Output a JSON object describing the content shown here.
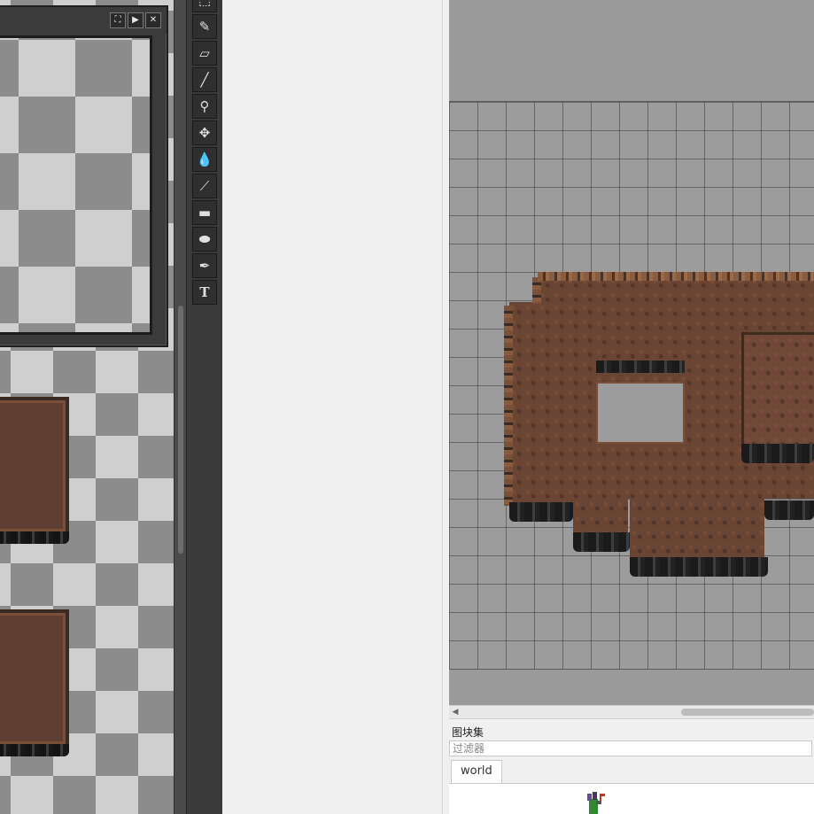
{
  "preview": {
    "buttons": [
      {
        "glyph": "⛶",
        "icon": "fullscreen-icon"
      },
      {
        "glyph": "▶",
        "icon": "play-icon"
      },
      {
        "glyph": "✕",
        "icon": "close-icon"
      }
    ]
  },
  "toolbar": {
    "tools": [
      {
        "glyph": "⬚",
        "icon": "selection-icon"
      },
      {
        "glyph": "✎",
        "icon": "pencil-icon"
      },
      {
        "glyph": "▱",
        "icon": "eraser-icon"
      },
      {
        "glyph": "╱",
        "icon": "brush-icon"
      },
      {
        "glyph": "⚲",
        "icon": "zoom-icon"
      },
      {
        "glyph": "✥",
        "icon": "move-icon"
      },
      {
        "glyph": "💧",
        "icon": "fill-icon"
      },
      {
        "glyph": "⟋",
        "icon": "line-icon"
      },
      {
        "glyph": "▬",
        "icon": "rectangle-icon"
      },
      {
        "glyph": "⬬",
        "icon": "ellipse-icon"
      },
      {
        "glyph": "✒",
        "icon": "spray-icon"
      },
      {
        "glyph": "T",
        "icon": "text-icon"
      }
    ]
  },
  "tileset_panel": {
    "title": "图块集",
    "filter_placeholder": "过滤器",
    "tabs": [
      {
        "label": "world"
      }
    ]
  }
}
